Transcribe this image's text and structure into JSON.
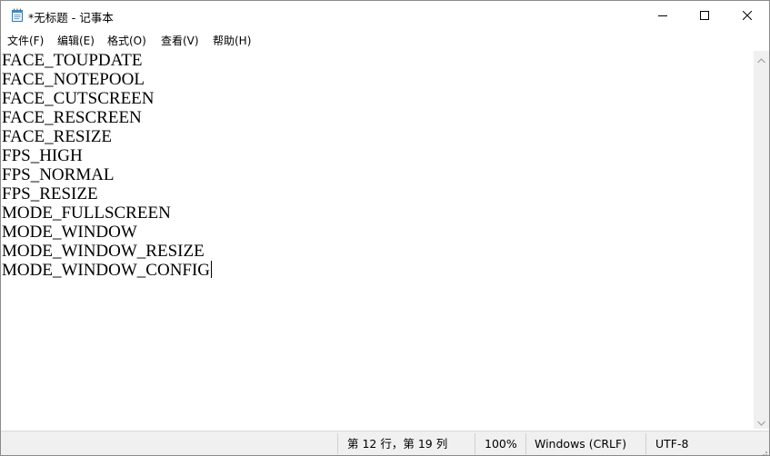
{
  "window": {
    "title": "*无标题 - 记事本",
    "icon": "notepad-icon",
    "controls": {
      "minimize": "minimize-icon",
      "maximize": "maximize-icon",
      "close": "close-icon"
    }
  },
  "menu": {
    "items": [
      "文件(F)",
      "编辑(E)",
      "格式(O)",
      "查看(V)",
      "帮助(H)"
    ]
  },
  "editor": {
    "lines": [
      "FACE_TOUPDATE",
      "FACE_NOTEPOOL",
      "FACE_CUTSCREEN",
      "FACE_RESCREEN",
      "FACE_RESIZE",
      "FPS_HIGH",
      "FPS_NORMAL",
      "FPS_RESIZE",
      "MODE_FULLSCREEN",
      "MODE_WINDOW",
      "MODE_WINDOW_RESIZE",
      "MODE_WINDOW_CONFIG"
    ]
  },
  "status": {
    "position": "第 12 行，第 19 列",
    "zoom": "100%",
    "line_ending": "Windows (CRLF)",
    "encoding": "UTF-8"
  },
  "colors": {
    "chrome_bg": "#f0f0f0",
    "editor_bg": "#ffffff",
    "text": "#000000"
  }
}
